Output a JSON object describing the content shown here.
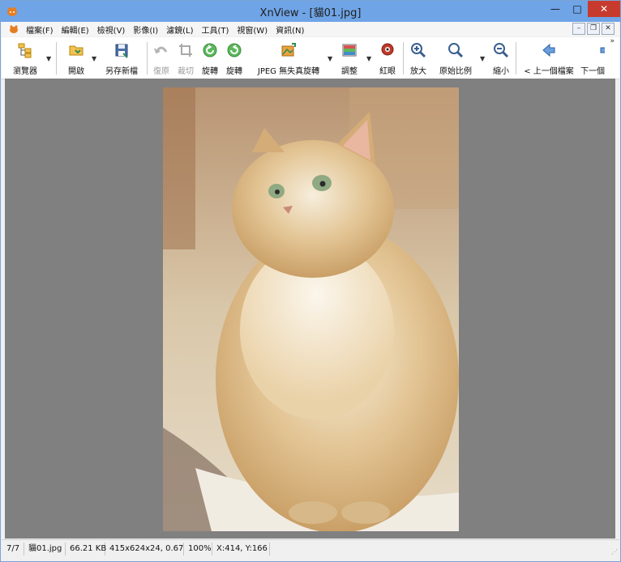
{
  "window": {
    "title": "XnView - [貓01.jpg]",
    "min_glyph": "—",
    "max_glyph": "□",
    "close_glyph": "✕"
  },
  "menu": {
    "items": [
      {
        "label": "檔案(F)"
      },
      {
        "label": "編輯(E)"
      },
      {
        "label": "檢視(V)"
      },
      {
        "label": "影像(I)"
      },
      {
        "label": "濾鏡(L)"
      },
      {
        "label": "工具(T)"
      },
      {
        "label": "視窗(W)"
      },
      {
        "label": "資訊(N)"
      }
    ],
    "mdi": {
      "min": "–",
      "restore": "❐",
      "close": "✕"
    }
  },
  "toolbar": {
    "browser": "瀏覽器",
    "open": "開啟",
    "save_as": "另存新檔",
    "undo": "復原",
    "crop": "裁切",
    "rotate_left": "旋轉",
    "rotate_right": "旋轉",
    "jpeg_lossless": "JPEG 無失真旋轉",
    "adjust": "調整",
    "red_eye": "紅眼",
    "zoom_in": "放大",
    "original_ratio": "原始比例",
    "zoom_out": "縮小",
    "prev_file": "< 上一個檔案",
    "next_file": "下一個",
    "more": "»"
  },
  "image": {
    "subject": "long-haired cream cat photo"
  },
  "status": {
    "index": "7/7",
    "filename": "貓01.jpg",
    "filesize": "66.21 KB",
    "dimensions": "415x624x24, 0.67",
    "zoom": "100%",
    "cursor": "X:414, Y:166"
  },
  "colors": {
    "titlebar": "#6fa4e6",
    "close_button": "#c73b2e",
    "canvas_bg": "#808080"
  }
}
